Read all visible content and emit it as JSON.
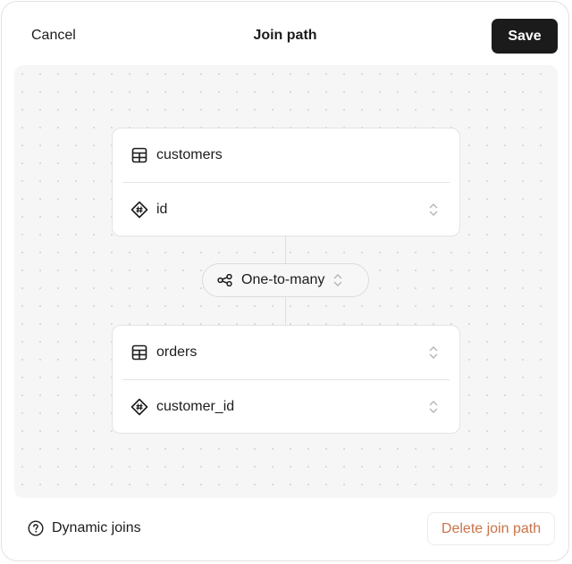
{
  "header": {
    "cancel_label": "Cancel",
    "title": "Join path",
    "save_label": "Save"
  },
  "join": {
    "source": {
      "table": "customers",
      "table_icon": "table-icon",
      "column": "id",
      "column_icon": "key-hash-icon"
    },
    "relationship": {
      "label": "One-to-many",
      "icon": "relationship-icon"
    },
    "target": {
      "table": "orders",
      "table_icon": "table-icon",
      "column": "customer_id",
      "column_icon": "key-hash-icon"
    }
  },
  "footer": {
    "help_label": "Dynamic joins",
    "help_icon": "question-circle-icon",
    "delete_label": "Delete join path"
  },
  "colors": {
    "save_bg": "#1b1b1b",
    "delete_text": "#c8734a",
    "canvas_bg": "#f6f6f6"
  }
}
